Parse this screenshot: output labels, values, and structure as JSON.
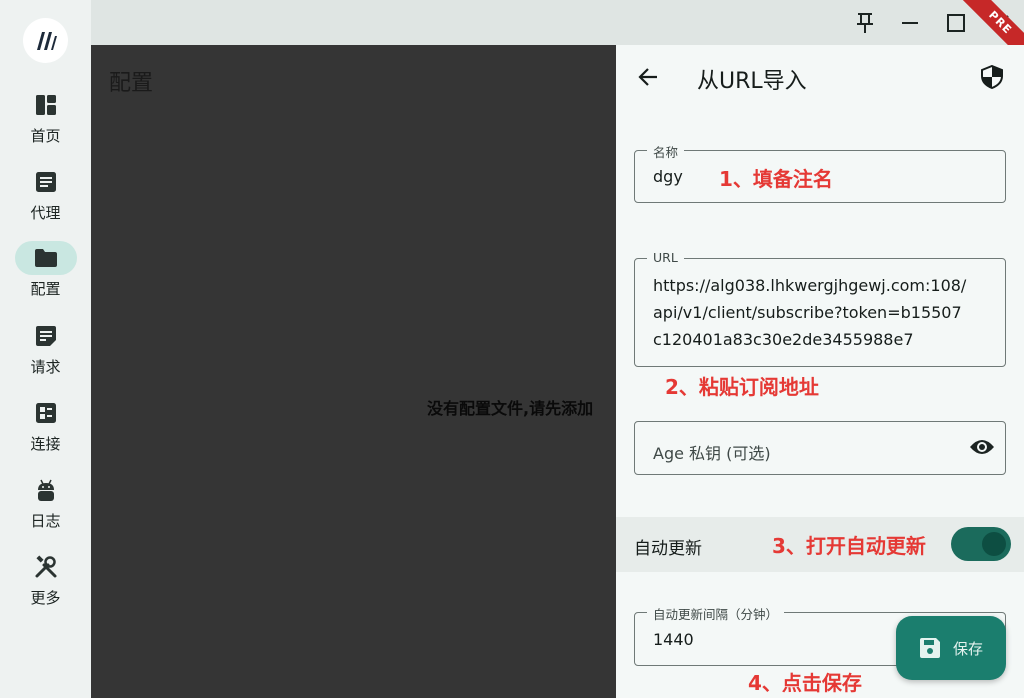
{
  "sidebar": {
    "items": [
      {
        "label": "首页",
        "icon": "dashboard-icon"
      },
      {
        "label": "代理",
        "icon": "article-icon"
      },
      {
        "label": "配置",
        "icon": "folder-icon",
        "active": true
      },
      {
        "label": "请求",
        "icon": "notes-icon"
      },
      {
        "label": "连接",
        "icon": "grid-icon"
      },
      {
        "label": "日志",
        "icon": "android-icon"
      },
      {
        "label": "更多",
        "icon": "tools-icon"
      }
    ]
  },
  "titlebar": {
    "badge": "PRE"
  },
  "main": {
    "title": "配置",
    "empty_message": "没有配置文件,请先添加"
  },
  "panel": {
    "title": "从URL导入",
    "name_field": {
      "label": "名称",
      "value": "dgy"
    },
    "url_field": {
      "label": "URL",
      "lines": [
        "https://alg038.lhkwergjhgewj.com:108/",
        "api/v1/client/subscribe?token=b15507",
        "c120401a83c30e2de3455988e7"
      ]
    },
    "age_field": {
      "placeholder": "Age 私钥 (可选)"
    },
    "auto_update": {
      "label": "自动更新",
      "enabled": true
    },
    "interval_field": {
      "label": "自动更新间隔（分钟）",
      "value": "1440"
    },
    "save_label": "保存"
  },
  "annotations": {
    "step1": "1、填备注名",
    "step2": "2、粘贴订阅地址",
    "step3": "3、打开自动更新",
    "step4": "4、点击保存"
  },
  "colors": {
    "accent": "#1b7e6e",
    "annotation": "#e53935",
    "active_nav": "#c9e7e1"
  }
}
